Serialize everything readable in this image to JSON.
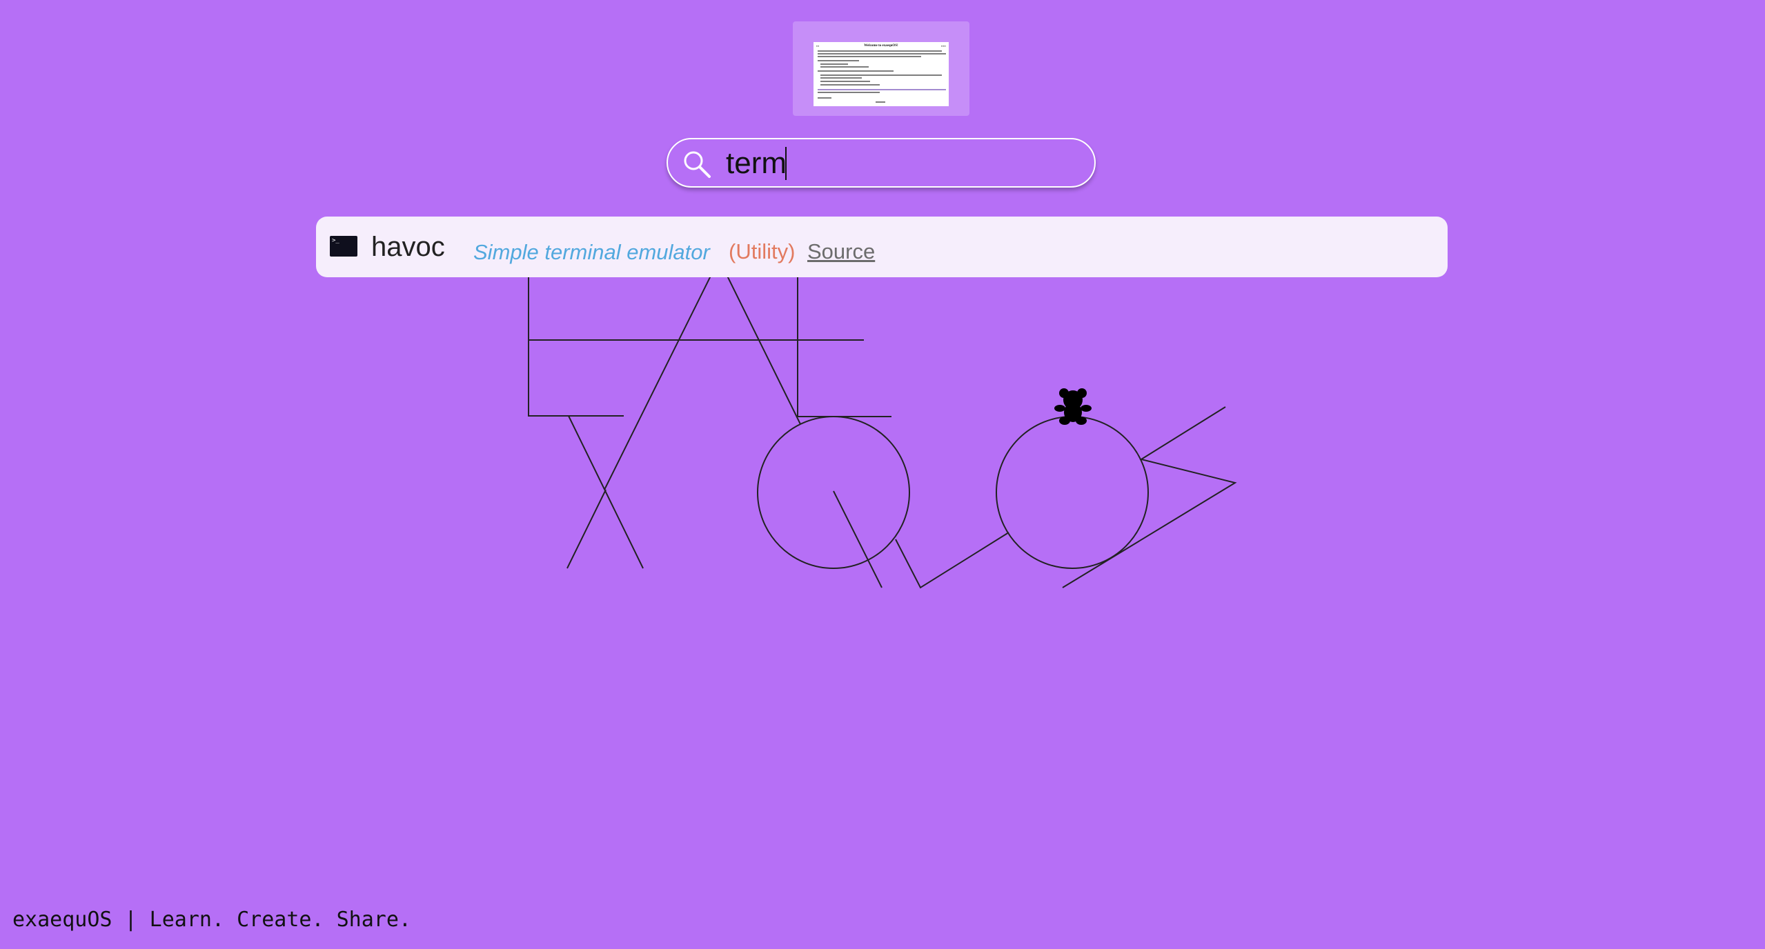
{
  "colors": {
    "background": "#b66ff6",
    "results_panel": "#f6eefc",
    "description": "#52a8de",
    "category": "#e27a5f",
    "source_link": "#6c6c6c"
  },
  "window_thumbnail": {
    "title": "Welcome to exaequOS!"
  },
  "search": {
    "value": "term",
    "icon": "search-icon"
  },
  "results": [
    {
      "icon": "terminal-icon",
      "name": "havoc",
      "description": "Simple terminal emulator",
      "category": "(Utility)",
      "link": "Source"
    }
  ],
  "footer": {
    "text": "exaequOS | Learn. Create. Share."
  }
}
